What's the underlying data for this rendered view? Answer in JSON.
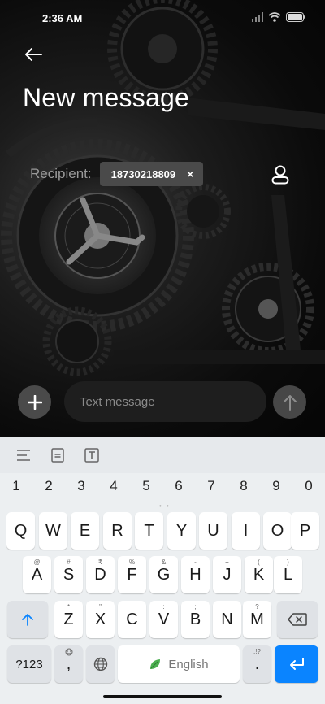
{
  "status_bar": {
    "time": "2:36 AM",
    "icons": [
      "signal-icon",
      "wifi-icon",
      "battery-icon"
    ]
  },
  "header": {
    "back_icon": "arrow-left-icon",
    "title": "New message"
  },
  "recipient": {
    "label": "Recipient:",
    "chip_value": "18730218809",
    "chip_remove": "×",
    "contact_icon": "person-icon"
  },
  "compose": {
    "add_icon": "plus-icon",
    "placeholder": "Text message",
    "send_icon": "arrow-up-icon"
  },
  "keyboard": {
    "toolbar_icons": [
      "menu-lines-icon",
      "clipboard-icon",
      "text-format-icon"
    ],
    "number_row": [
      "1",
      "2",
      "3",
      "4",
      "5",
      "6",
      "7",
      "8",
      "9",
      "0"
    ],
    "row1": [
      "Q",
      "W",
      "E",
      "R",
      "T",
      "Y",
      "U",
      "I",
      "O",
      "P"
    ],
    "row2": [
      {
        "key": "A",
        "alt": "@"
      },
      {
        "key": "S",
        "alt": "#"
      },
      {
        "key": "D",
        "alt": "₹"
      },
      {
        "key": "F",
        "alt": "%"
      },
      {
        "key": "G",
        "alt": "&"
      },
      {
        "key": "H",
        "alt": "-"
      },
      {
        "key": "J",
        "alt": "+"
      },
      {
        "key": "K",
        "alt": "("
      },
      {
        "key": "L",
        "alt": ")"
      }
    ],
    "row3": [
      {
        "key": "Z",
        "alt": "*"
      },
      {
        "key": "X",
        "alt": "\""
      },
      {
        "key": "C",
        "alt": "'"
      },
      {
        "key": "V",
        "alt": ":"
      },
      {
        "key": "B",
        "alt": ";"
      },
      {
        "key": "N",
        "alt": "!"
      },
      {
        "key": "M",
        "alt": "?"
      }
    ],
    "symbols_label": "?123",
    "comma": ",",
    "space_label": "English",
    "period": ".",
    "period_alt": ",!?",
    "colors": {
      "accent": "#0a84ff",
      "background": "#eceff1"
    }
  }
}
